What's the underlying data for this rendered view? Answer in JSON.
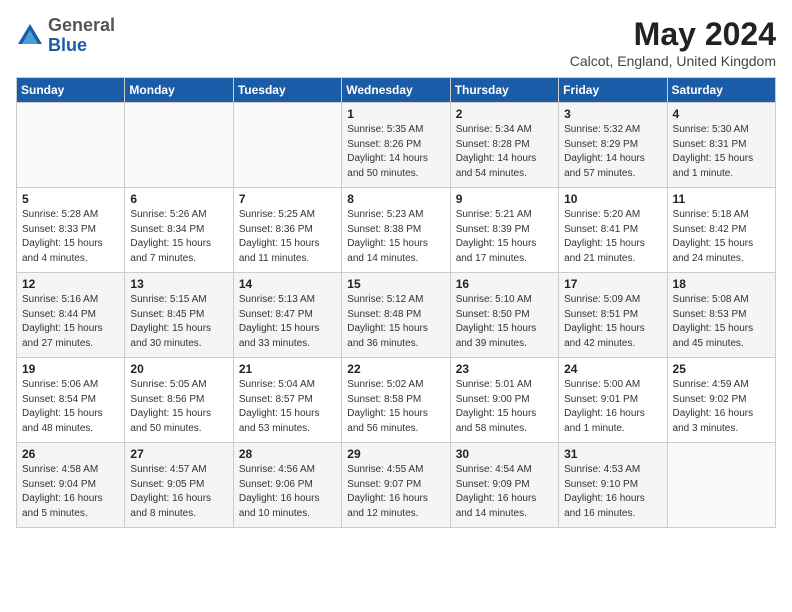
{
  "logo": {
    "general": "General",
    "blue": "Blue"
  },
  "title": "May 2024",
  "location": "Calcot, England, United Kingdom",
  "days_of_week": [
    "Sunday",
    "Monday",
    "Tuesday",
    "Wednesday",
    "Thursday",
    "Friday",
    "Saturday"
  ],
  "weeks": [
    [
      {
        "num": "",
        "info": ""
      },
      {
        "num": "",
        "info": ""
      },
      {
        "num": "",
        "info": ""
      },
      {
        "num": "1",
        "info": "Sunrise: 5:35 AM\nSunset: 8:26 PM\nDaylight: 14 hours\nand 50 minutes."
      },
      {
        "num": "2",
        "info": "Sunrise: 5:34 AM\nSunset: 8:28 PM\nDaylight: 14 hours\nand 54 minutes."
      },
      {
        "num": "3",
        "info": "Sunrise: 5:32 AM\nSunset: 8:29 PM\nDaylight: 14 hours\nand 57 minutes."
      },
      {
        "num": "4",
        "info": "Sunrise: 5:30 AM\nSunset: 8:31 PM\nDaylight: 15 hours\nand 1 minute."
      }
    ],
    [
      {
        "num": "5",
        "info": "Sunrise: 5:28 AM\nSunset: 8:33 PM\nDaylight: 15 hours\nand 4 minutes."
      },
      {
        "num": "6",
        "info": "Sunrise: 5:26 AM\nSunset: 8:34 PM\nDaylight: 15 hours\nand 7 minutes."
      },
      {
        "num": "7",
        "info": "Sunrise: 5:25 AM\nSunset: 8:36 PM\nDaylight: 15 hours\nand 11 minutes."
      },
      {
        "num": "8",
        "info": "Sunrise: 5:23 AM\nSunset: 8:38 PM\nDaylight: 15 hours\nand 14 minutes."
      },
      {
        "num": "9",
        "info": "Sunrise: 5:21 AM\nSunset: 8:39 PM\nDaylight: 15 hours\nand 17 minutes."
      },
      {
        "num": "10",
        "info": "Sunrise: 5:20 AM\nSunset: 8:41 PM\nDaylight: 15 hours\nand 21 minutes."
      },
      {
        "num": "11",
        "info": "Sunrise: 5:18 AM\nSunset: 8:42 PM\nDaylight: 15 hours\nand 24 minutes."
      }
    ],
    [
      {
        "num": "12",
        "info": "Sunrise: 5:16 AM\nSunset: 8:44 PM\nDaylight: 15 hours\nand 27 minutes."
      },
      {
        "num": "13",
        "info": "Sunrise: 5:15 AM\nSunset: 8:45 PM\nDaylight: 15 hours\nand 30 minutes."
      },
      {
        "num": "14",
        "info": "Sunrise: 5:13 AM\nSunset: 8:47 PM\nDaylight: 15 hours\nand 33 minutes."
      },
      {
        "num": "15",
        "info": "Sunrise: 5:12 AM\nSunset: 8:48 PM\nDaylight: 15 hours\nand 36 minutes."
      },
      {
        "num": "16",
        "info": "Sunrise: 5:10 AM\nSunset: 8:50 PM\nDaylight: 15 hours\nand 39 minutes."
      },
      {
        "num": "17",
        "info": "Sunrise: 5:09 AM\nSunset: 8:51 PM\nDaylight: 15 hours\nand 42 minutes."
      },
      {
        "num": "18",
        "info": "Sunrise: 5:08 AM\nSunset: 8:53 PM\nDaylight: 15 hours\nand 45 minutes."
      }
    ],
    [
      {
        "num": "19",
        "info": "Sunrise: 5:06 AM\nSunset: 8:54 PM\nDaylight: 15 hours\nand 48 minutes."
      },
      {
        "num": "20",
        "info": "Sunrise: 5:05 AM\nSunset: 8:56 PM\nDaylight: 15 hours\nand 50 minutes."
      },
      {
        "num": "21",
        "info": "Sunrise: 5:04 AM\nSunset: 8:57 PM\nDaylight: 15 hours\nand 53 minutes."
      },
      {
        "num": "22",
        "info": "Sunrise: 5:02 AM\nSunset: 8:58 PM\nDaylight: 15 hours\nand 56 minutes."
      },
      {
        "num": "23",
        "info": "Sunrise: 5:01 AM\nSunset: 9:00 PM\nDaylight: 15 hours\nand 58 minutes."
      },
      {
        "num": "24",
        "info": "Sunrise: 5:00 AM\nSunset: 9:01 PM\nDaylight: 16 hours\nand 1 minute."
      },
      {
        "num": "25",
        "info": "Sunrise: 4:59 AM\nSunset: 9:02 PM\nDaylight: 16 hours\nand 3 minutes."
      }
    ],
    [
      {
        "num": "26",
        "info": "Sunrise: 4:58 AM\nSunset: 9:04 PM\nDaylight: 16 hours\nand 5 minutes."
      },
      {
        "num": "27",
        "info": "Sunrise: 4:57 AM\nSunset: 9:05 PM\nDaylight: 16 hours\nand 8 minutes."
      },
      {
        "num": "28",
        "info": "Sunrise: 4:56 AM\nSunset: 9:06 PM\nDaylight: 16 hours\nand 10 minutes."
      },
      {
        "num": "29",
        "info": "Sunrise: 4:55 AM\nSunset: 9:07 PM\nDaylight: 16 hours\nand 12 minutes."
      },
      {
        "num": "30",
        "info": "Sunrise: 4:54 AM\nSunset: 9:09 PM\nDaylight: 16 hours\nand 14 minutes."
      },
      {
        "num": "31",
        "info": "Sunrise: 4:53 AM\nSunset: 9:10 PM\nDaylight: 16 hours\nand 16 minutes."
      },
      {
        "num": "",
        "info": ""
      }
    ]
  ]
}
